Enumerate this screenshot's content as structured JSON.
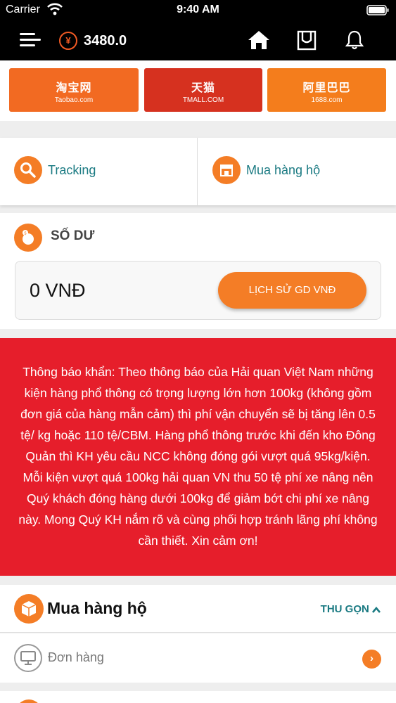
{
  "status_bar": {
    "carrier": "Carrier",
    "time": "9:40 AM"
  },
  "header": {
    "currency_symbol": "¥",
    "balance": "3480.0"
  },
  "banners": {
    "taobao": {
      "main": "淘宝网",
      "sub": "Taobao.com",
      "color": "#f26a22"
    },
    "tmall": {
      "main": "天猫",
      "sub": "TMALL.COM",
      "color": "#d6311f"
    },
    "alibaba": {
      "main": "阿里巴巴",
      "sub": "1688.com",
      "color": "#f47d1c"
    }
  },
  "quick_actions": {
    "tracking_label": "Tracking",
    "order_label": "Mua hàng hộ"
  },
  "balance_card": {
    "title": "SỐ DƯ",
    "amount": "0 VNĐ",
    "history_button": "LỊCH SỬ GD VNĐ"
  },
  "notice": {
    "text": "Thông báo khẩn: Theo thông báo của Hải quan Việt Nam những kiện hàng phổ thông có trọng lượng lớn hơn 100kg (không gồm đơn giá của hàng mẫn cảm) thì phí vận chuyển sẽ bị tăng lên 0.5 tệ/ kg hoặc 110 tệ/CBM. Hàng phổ thông trước khi đến kho Đông Quản thì KH yêu cầu NCC không đóng gói vượt quá 95kg/kiện. Mỗi kiện vượt quá 100kg hải quan VN thu 50 tệ phí xe nâng nên Quý khách đóng hàng dưới 100kg để giảm bớt chi phí xe nâng này. Mong Quý KH nắm rõ và cùng phối hợp tránh lãng phí không cần thiết. Xin cảm ơn!",
    "color": "#e61e2b"
  },
  "section": {
    "title": "Mua hàng hộ",
    "toggle_label": "THU GỌN"
  },
  "order_row": {
    "label": "Đơn hàng"
  },
  "colors": {
    "accent": "#f47d26",
    "teal": "#1a7a82"
  },
  "icons": {
    "wifi": "wifi-icon",
    "battery": "battery-icon",
    "menu": "menu-icon",
    "yen": "yen-icon",
    "home": "home-icon",
    "bag": "shopping-bag-icon",
    "bell": "bell-icon",
    "search": "search-icon",
    "store": "store-icon",
    "piggy": "piggy-bank-icon",
    "box": "box-icon",
    "monitor": "monitor-icon",
    "chevron_up": "chevron-up-icon",
    "chevron_right": "chevron-right-icon"
  }
}
